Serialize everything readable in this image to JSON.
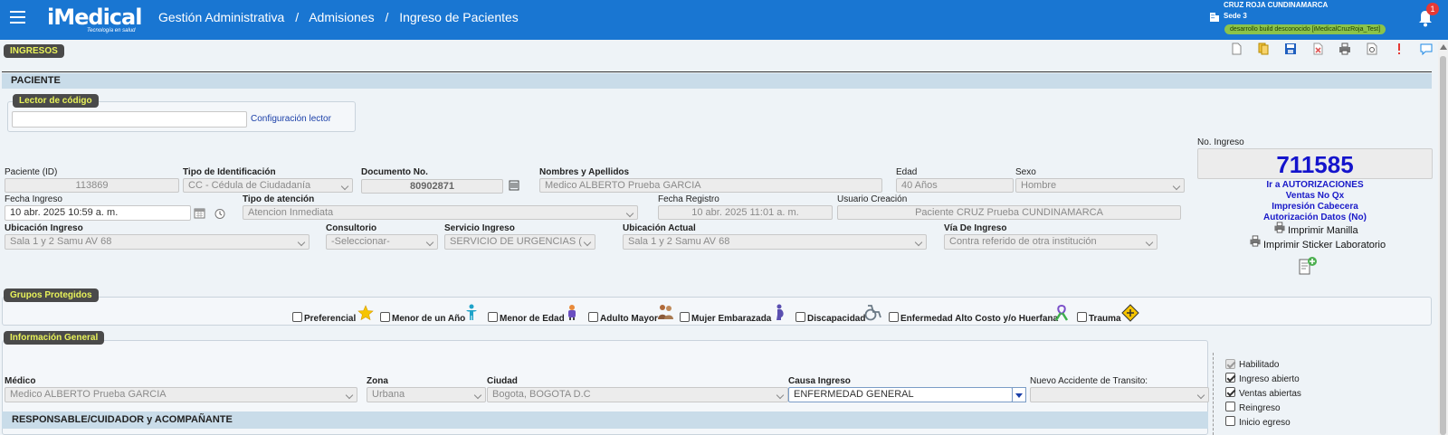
{
  "header": {
    "logo": "iMedical",
    "logo_tagline": "Tecnología en salud",
    "breadcrumb": [
      "Gestión Administrativa",
      "Admisiones",
      "Ingreso de Pacientes"
    ],
    "breadcrumb_sep": "/",
    "organization": "CRUZ ROJA CUNDINAMARCA",
    "sede": "Sede 3",
    "build": "desarrollo build desconocido [iMedicalCruzRoja_Test]",
    "notification_count": "1"
  },
  "toolbar": {
    "icons": [
      "new-document-icon",
      "copy-icon",
      "save-icon",
      "delete-icon",
      "print-icon",
      "preview-icon",
      "alert-icon",
      "chat-icon"
    ],
    "colors": {
      "save": "#1f5fbf",
      "delete": "#e05a5a",
      "alert": "#e53935",
      "chat": "#1e88e5"
    }
  },
  "sections": {
    "ingresos": "INGRESOS",
    "paciente": "PACIENTE",
    "lector": "Lector de código",
    "grupos": "Grupos Protegidos",
    "info_general": "Información General",
    "responsable": "RESPONSABLE/CUIDADOR y ACOMPAÑANTE"
  },
  "lector": {
    "value": "",
    "config_link": "Configuración lector"
  },
  "ingreso": {
    "label": "No. Ingreso",
    "number": "711585",
    "links": [
      "Ir a AUTORIZACIONES",
      "Ventas No Qx",
      "Impresión Cabecera",
      "Autorización Datos (No)"
    ],
    "print_manilla": "Imprimir Manilla",
    "print_sticker": "Imprimir Sticker Laboratorio"
  },
  "patient": {
    "paciente_id_label": "Paciente (ID)",
    "paciente_id": "113869",
    "tipo_id_label": "Tipo de Identificación",
    "tipo_id": "CC - Cédula de Ciudadanía",
    "documento_label": "Documento No.",
    "documento": "80902871",
    "nombres_label": "Nombres y Apellidos",
    "nombres": "Medico ALBERTO Prueba GARCIA",
    "edad_label": "Edad",
    "edad": "40  Años",
    "sexo_label": "Sexo",
    "sexo": "Hombre",
    "fecha_ingreso_label": "Fecha Ingreso",
    "fecha_ingreso": "10 abr. 2025 10:59 a. m.",
    "tipo_atencion_label": "Tipo de atención",
    "tipo_atencion": "Atencion Inmediata",
    "fecha_registro_label": "Fecha Registro",
    "fecha_registro": "10 abr. 2025 11:01 a. m.",
    "usuario_label": "Usuario Creación",
    "usuario": "Paciente CRUZ Prueba CUNDINAMARCA",
    "ubicacion_ingreso_label": "Ubicación Ingreso",
    "ubicacion_ingreso": "Sala 1 y 2 Samu AV 68",
    "consultorio_label": "Consultorio",
    "consultorio": "-Seleccionar-",
    "servicio_label": "Servicio Ingreso",
    "servicio": "SERVICIO DE URGENCIAS (",
    "ubicacion_actual_label": "Ubicación Actual",
    "ubicacion_actual": "Sala 1 y 2 Samu AV 68",
    "via_label": "Vía De Ingreso",
    "via": "Contra referido de otra institución"
  },
  "grupos": [
    {
      "label": "Preferencial",
      "icon": "star-icon"
    },
    {
      "label": "Menor de un Año",
      "icon": "baby-icon"
    },
    {
      "label": "Menor de Edad",
      "icon": "child-icon"
    },
    {
      "label": "Adulto Mayor",
      "icon": "elderly-icon"
    },
    {
      "label": "Mujer Embarazada",
      "icon": "pregnant-icon"
    },
    {
      "label": "Discapacidad",
      "icon": "wheelchair-icon"
    },
    {
      "label": "Enfermedad Alto Costo y/o Huerfana",
      "icon": "ribbon-icon"
    },
    {
      "label": "Trauma",
      "icon": "warning-icon"
    }
  ],
  "info": {
    "medico_label": "Médico",
    "medico": "Medico ALBERTO Prueba GARCIA",
    "zona_label": "Zona",
    "zona": "Urbana",
    "ciudad_label": "Ciudad",
    "ciudad": "Bogota, BOGOTA D.C",
    "causa_label": "Causa Ingreso",
    "causa": "ENFERMEDAD GENERAL",
    "accidente_label": "Nuevo Accidente de Transito:",
    "accidente": ""
  },
  "status_checks": [
    {
      "label": "Habilitado",
      "checked": true,
      "disabled": true
    },
    {
      "label": "Ingreso abierto",
      "checked": true,
      "disabled": false
    },
    {
      "label": "Ventas abiertas",
      "checked": true,
      "disabled": false
    },
    {
      "label": "Reingreso",
      "checked": false,
      "disabled": false
    },
    {
      "label": "Inicio egreso",
      "checked": false,
      "disabled": false
    }
  ]
}
